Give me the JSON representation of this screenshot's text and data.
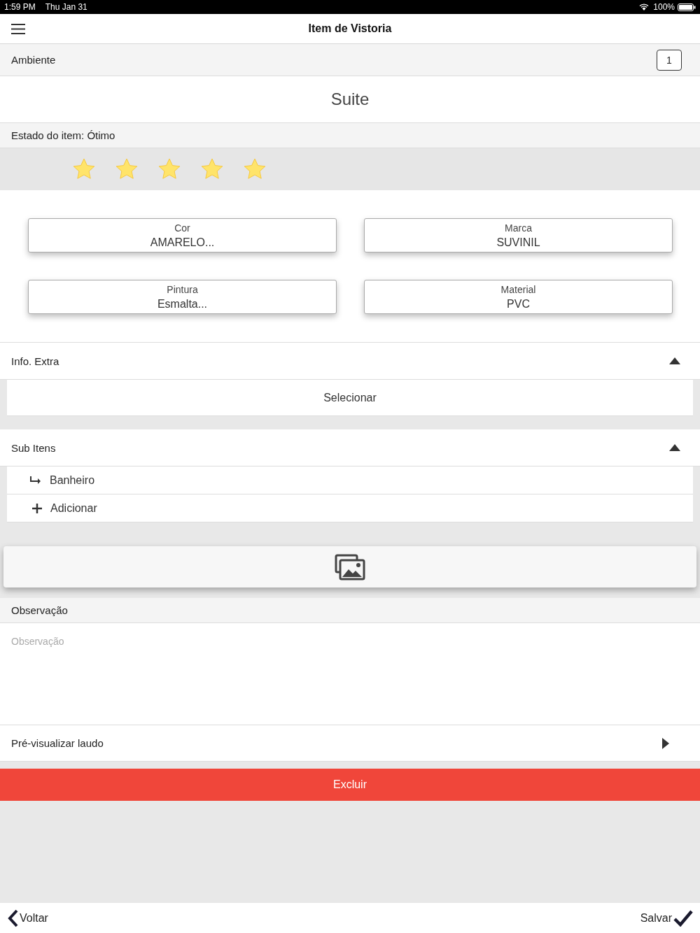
{
  "status_bar": {
    "time": "1:59 PM",
    "date": "Thu Jan 31",
    "battery": "100%"
  },
  "nav": {
    "title": "Item de Vistoria"
  },
  "ambiente": {
    "label": "Ambiente",
    "count": "1",
    "name": "Suite"
  },
  "estado": {
    "label": "Estado do item: Ótimo",
    "stars": 5
  },
  "fields": [
    {
      "label": "Cor",
      "value": "AMARELO..."
    },
    {
      "label": "Marca",
      "value": "SUVINIL"
    },
    {
      "label": "Pintura",
      "value": "Esmalta..."
    },
    {
      "label": "Material",
      "value": "PVC"
    }
  ],
  "info_extra": {
    "title": "Info. Extra",
    "expanded": true,
    "action": "Selecionar"
  },
  "sub_itens": {
    "title": "Sub Itens",
    "expanded": true,
    "items": [
      {
        "kind": "item",
        "label": "Banheiro"
      },
      {
        "kind": "add",
        "label": "Adicionar"
      }
    ]
  },
  "observacao": {
    "title": "Observação",
    "placeholder": "Observação"
  },
  "preview": {
    "label": "Pré-visualizar laudo"
  },
  "delete_button": "Excluir",
  "bottom_bar": {
    "back": "Voltar",
    "save": "Salvar"
  }
}
